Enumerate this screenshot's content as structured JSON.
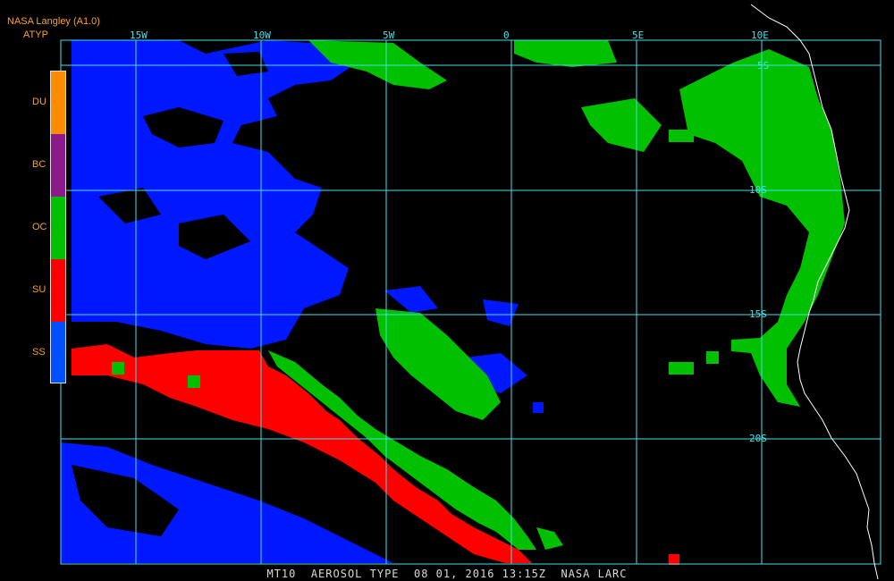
{
  "header": {
    "source": "NASA Langley (A1.0)",
    "product": "ATYP"
  },
  "legend": {
    "items": [
      {
        "code": "DU",
        "color": "#ff8c00"
      },
      {
        "code": "BC",
        "color": "#8b1a8b"
      },
      {
        "code": "OC",
        "color": "#00c000"
      },
      {
        "code": "SU",
        "color": "#ff0000"
      },
      {
        "code": "SS",
        "color": "#0050ff"
      }
    ]
  },
  "grid": {
    "lon_labels": [
      "15W",
      "10W",
      "5W",
      "0",
      "5E",
      "10E"
    ],
    "lat_labels": [
      "5S",
      "10S",
      "15S",
      "20S"
    ],
    "color": "#44e0e6"
  },
  "caption": "MT10  AEROSOL TYPE  08 01, 2016 13:15Z  NASA LARC",
  "colors": {
    "background": "#000000",
    "coastline": "#ffffff"
  }
}
